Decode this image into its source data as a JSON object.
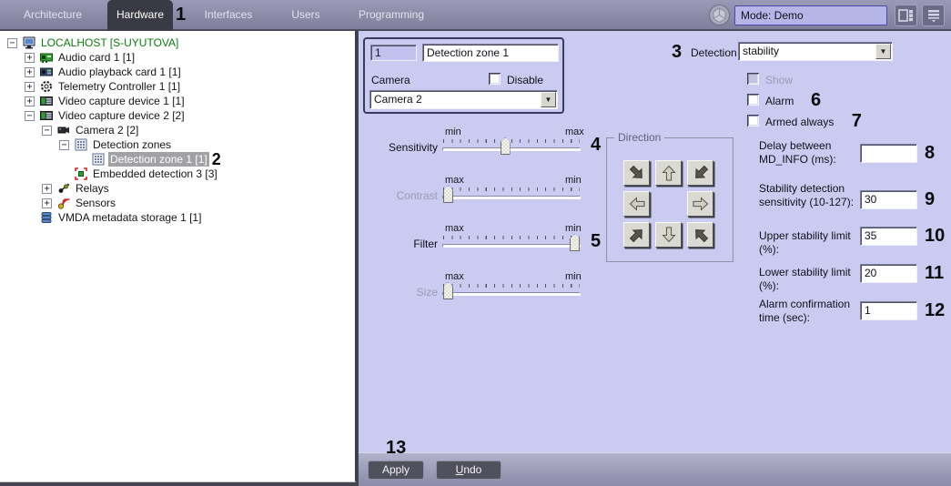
{
  "topbar": {
    "tabs": [
      {
        "label": "Architecture",
        "active": false
      },
      {
        "label": "Hardware",
        "active": true,
        "annotation": "1"
      },
      {
        "label": "Interfaces",
        "active": false
      },
      {
        "label": "Users",
        "active": false
      },
      {
        "label": "Programming",
        "active": false
      }
    ],
    "mode_field": "Mode: Demo",
    "icons": [
      "sphere-icon",
      "screens-grid-icon",
      "panel-menu-icon"
    ]
  },
  "tree": {
    "items": [
      {
        "label": "LOCALHOST [S-UYUTOVA]",
        "level": 0,
        "expand": "-",
        "icon": "computer-icon",
        "color": "#0c7c0c"
      },
      {
        "label": "Audio card 1 [1]",
        "level": 1,
        "expand": "+",
        "icon": "audio-card-icon"
      },
      {
        "label": "Audio playback card 1 [1]",
        "level": 1,
        "expand": "+",
        "icon": "audio-playback-icon"
      },
      {
        "label": "Telemetry Controller 1 [1]",
        "level": 1,
        "expand": "+",
        "icon": "telemetry-icon"
      },
      {
        "label": "Video capture device 1 [1]",
        "level": 1,
        "expand": "+",
        "icon": "video-capture-icon"
      },
      {
        "label": "Video capture device 2 [2]",
        "level": 1,
        "expand": "-",
        "icon": "video-capture-icon"
      },
      {
        "label": "Camera 2 [2]",
        "level": 2,
        "expand": "-",
        "icon": "camera-icon"
      },
      {
        "label": "Detection zones",
        "level": 3,
        "expand": "-",
        "icon": "detection-zones-icon"
      },
      {
        "label": "Detection zone 1 [1]",
        "level": 4,
        "expand": null,
        "icon": "detection-zone-icon",
        "selected": true,
        "annotation": "2"
      },
      {
        "label": "Embedded detection 3 [3]",
        "level": 3,
        "expand": null,
        "icon": "embedded-detection-icon"
      },
      {
        "label": "Relays",
        "level": 2,
        "expand": "+",
        "icon": "relays-icon"
      },
      {
        "label": "Sensors",
        "level": 2,
        "expand": "+",
        "icon": "sensors-icon"
      },
      {
        "label": "VMDA metadata storage 1 [1]",
        "level": 1,
        "expand": null,
        "icon": "vmda-storage-icon"
      }
    ]
  },
  "panel": {
    "id_value": "1",
    "name_value": "Detection zone 1",
    "camera_label": "Camera",
    "disable_label": "Disable",
    "camera_value": "Camera 2",
    "detection_label": "Detection",
    "detection_value": "stability",
    "detection_annotation": "3",
    "sliders": [
      {
        "label": "Sensitivity",
        "left": "min",
        "right": "max",
        "value_pct": 45,
        "enabled": true,
        "annotation": "4"
      },
      {
        "label": "Contrast",
        "left": "max",
        "right": "min",
        "value_pct": 0,
        "enabled": false,
        "annotation": ""
      },
      {
        "label": "Filter",
        "left": "max",
        "right": "min",
        "value_pct": 100,
        "enabled": true,
        "annotation": "5"
      },
      {
        "label": "Size",
        "left": "max",
        "right": "min",
        "value_pct": 0,
        "enabled": false,
        "annotation": ""
      }
    ],
    "direction": {
      "label": "Direction",
      "buttons": [
        "down-right",
        "up",
        "down-left",
        "left",
        "right",
        "up-right",
        "down",
        "up-left"
      ]
    },
    "checkboxes": [
      {
        "label": "Show",
        "disabled": true,
        "checked": false,
        "annotation": ""
      },
      {
        "label": "Alarm",
        "disabled": false,
        "checked": false,
        "annotation": "6"
      },
      {
        "label": "Armed always",
        "disabled": false,
        "checked": false,
        "annotation": "7"
      }
    ],
    "fields": [
      {
        "label": "Delay between MD_INFO (ms):",
        "value": "",
        "annotation": "8"
      },
      {
        "label": "Stability detection sensitivity (10-127):",
        "value": "30",
        "annotation": "9"
      },
      {
        "label": "Upper stability limit (%):",
        "value": "35",
        "annotation": "10"
      },
      {
        "label": "Lower stability limit (%):",
        "value": "20",
        "annotation": "11"
      },
      {
        "label": "Alarm confirmation time (sec):",
        "value": "1",
        "annotation": "12"
      }
    ]
  },
  "footer": {
    "apply_label": "Apply",
    "undo_label": "Undo",
    "annotation": "13"
  },
  "colors": {
    "panel_bg": "#cbcbf1",
    "topbar_bg": "#8a8aa8",
    "active_tab_bg": "#3a3a44",
    "tree_selected_bg": "#a2a2a6",
    "mode_field_bg": "#b5b5e8",
    "localhost_text": "#0c7c0c"
  }
}
